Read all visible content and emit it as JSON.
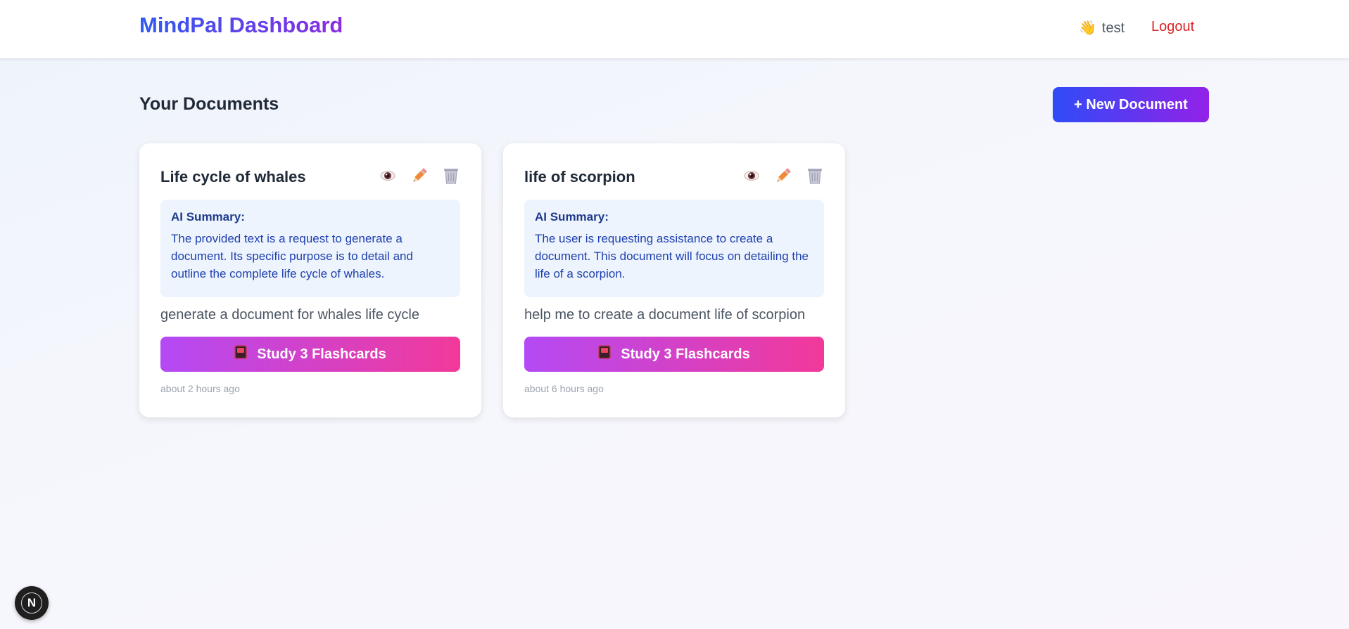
{
  "header": {
    "brand": "MindPal Dashboard",
    "user_name": "test",
    "logout_label": "Logout"
  },
  "main": {
    "title": "Your Documents",
    "new_document_label": "+ New Document"
  },
  "documents": [
    {
      "title": "Life cycle of whales",
      "summary_label": "AI Summary:",
      "summary": "The provided text is a request to generate a document. Its specific purpose is to detail and outline the complete life cycle of whales.",
      "prompt": "generate a document for whales life cycle",
      "study_label": "Study 3 Flashcards",
      "timestamp": "about 2 hours ago"
    },
    {
      "title": "life of scorpion",
      "summary_label": "AI Summary:",
      "summary": "The user is requesting assistance to create a document. This document will focus on detailing the life of a scorpion.",
      "prompt": "help me to create a document life of scorpion",
      "study_label": "Study 3 Flashcards",
      "timestamp": "about 6 hours ago"
    }
  ],
  "icons": {
    "user": "waving-hand-icon",
    "view": "eye-icon",
    "edit": "pencil-icon",
    "delete": "wastebasket-icon",
    "study": "flashcard-icon",
    "dev_badge": "nextjs-logo-icon"
  },
  "colors": {
    "brand_start": "#2f5bf1",
    "brand_end": "#8a2be2",
    "logout": "#dc2626",
    "study_start": "#b44af5",
    "study_end": "#f2399a",
    "summary_bg": "#eef4fd"
  }
}
